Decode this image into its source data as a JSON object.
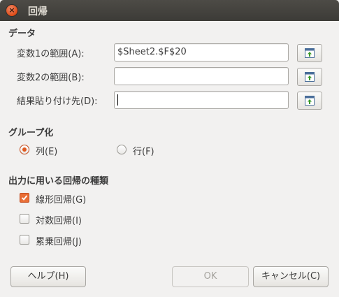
{
  "window": {
    "title": "回帰"
  },
  "data_section": {
    "title": "データ",
    "var1_label": "変数1の範囲(A):",
    "var1_value": "$Sheet2.$F$20",
    "var2_label": "変数2の範囲(B):",
    "var2_value": "",
    "output_label": "結果貼り付け先(D):",
    "output_value": ""
  },
  "group_section": {
    "title": "グループ化",
    "columns_label": "列(E)",
    "rows_label": "行(F)",
    "selected": "columns"
  },
  "types_section": {
    "title": "出力に用いる回帰の種類",
    "linear_label": "線形回帰(G)",
    "linear_checked": true,
    "log_label": "対数回帰(I)",
    "log_checked": false,
    "power_label": "累乗回帰(J)",
    "power_checked": false
  },
  "buttons": {
    "help": "ヘルプ(H)",
    "ok": "OK",
    "cancel": "キャンセル(C)"
  },
  "colors": {
    "accent": "#e05a20",
    "titlebar": "#3c3b37"
  }
}
